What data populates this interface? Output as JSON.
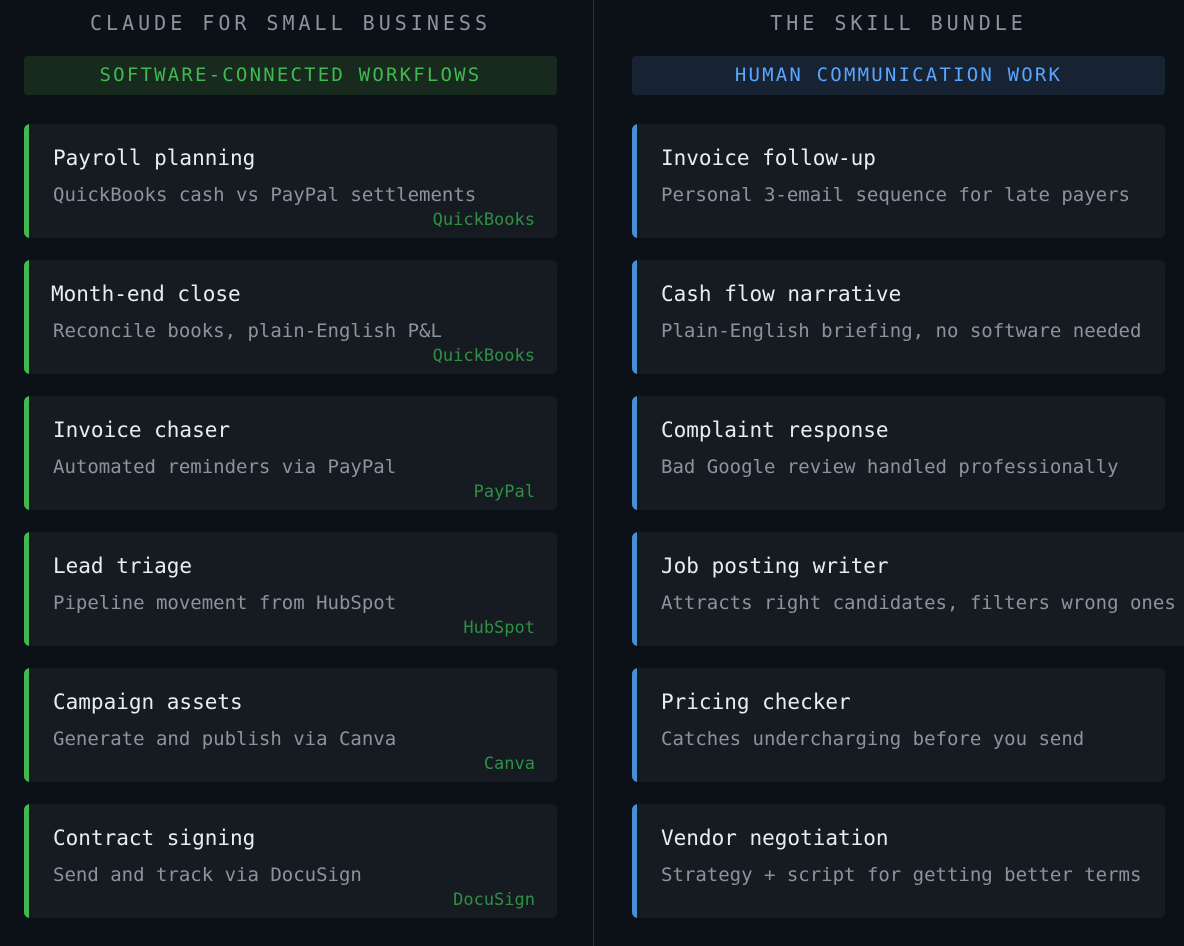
{
  "left_column": {
    "title": "CLAUDE FOR SMALL BUSINESS",
    "banner": "SOFTWARE-CONNECTED WORKFLOWS",
    "accent_color": "#3fb950",
    "cards": [
      {
        "title": "Payroll planning",
        "description": "QuickBooks cash vs PayPal settlements",
        "tag": "QuickBooks"
      },
      {
        "title": "Month-end close",
        "description": "Reconcile books, plain-English P&L",
        "tag": "QuickBooks"
      },
      {
        "title": "Invoice chaser",
        "description": "Automated reminders via PayPal",
        "tag": "PayPal"
      },
      {
        "title": "Lead triage",
        "description": "Pipeline movement from HubSpot",
        "tag": "HubSpot"
      },
      {
        "title": "Campaign assets",
        "description": "Generate and publish via Canva",
        "tag": "Canva"
      },
      {
        "title": "Contract signing",
        "description": "Send and track via DocuSign",
        "tag": "DocuSign"
      }
    ]
  },
  "right_column": {
    "title": "THE SKILL BUNDLE",
    "banner": "HUMAN COMMUNICATION WORK",
    "accent_color": "#58a6ff",
    "cards": [
      {
        "title": "Invoice follow-up",
        "description": "Personal 3-email sequence for late payers"
      },
      {
        "title": "Cash flow narrative",
        "description": "Plain-English briefing, no software needed"
      },
      {
        "title": "Complaint response",
        "description": "Bad Google review handled professionally"
      },
      {
        "title": "Job posting writer",
        "description": "Attracts right candidates, filters wrong ones"
      },
      {
        "title": "Pricing checker",
        "description": "Catches undercharging before you send"
      },
      {
        "title": "Vendor negotiation",
        "description": "Strategy + script for getting better terms"
      }
    ]
  }
}
